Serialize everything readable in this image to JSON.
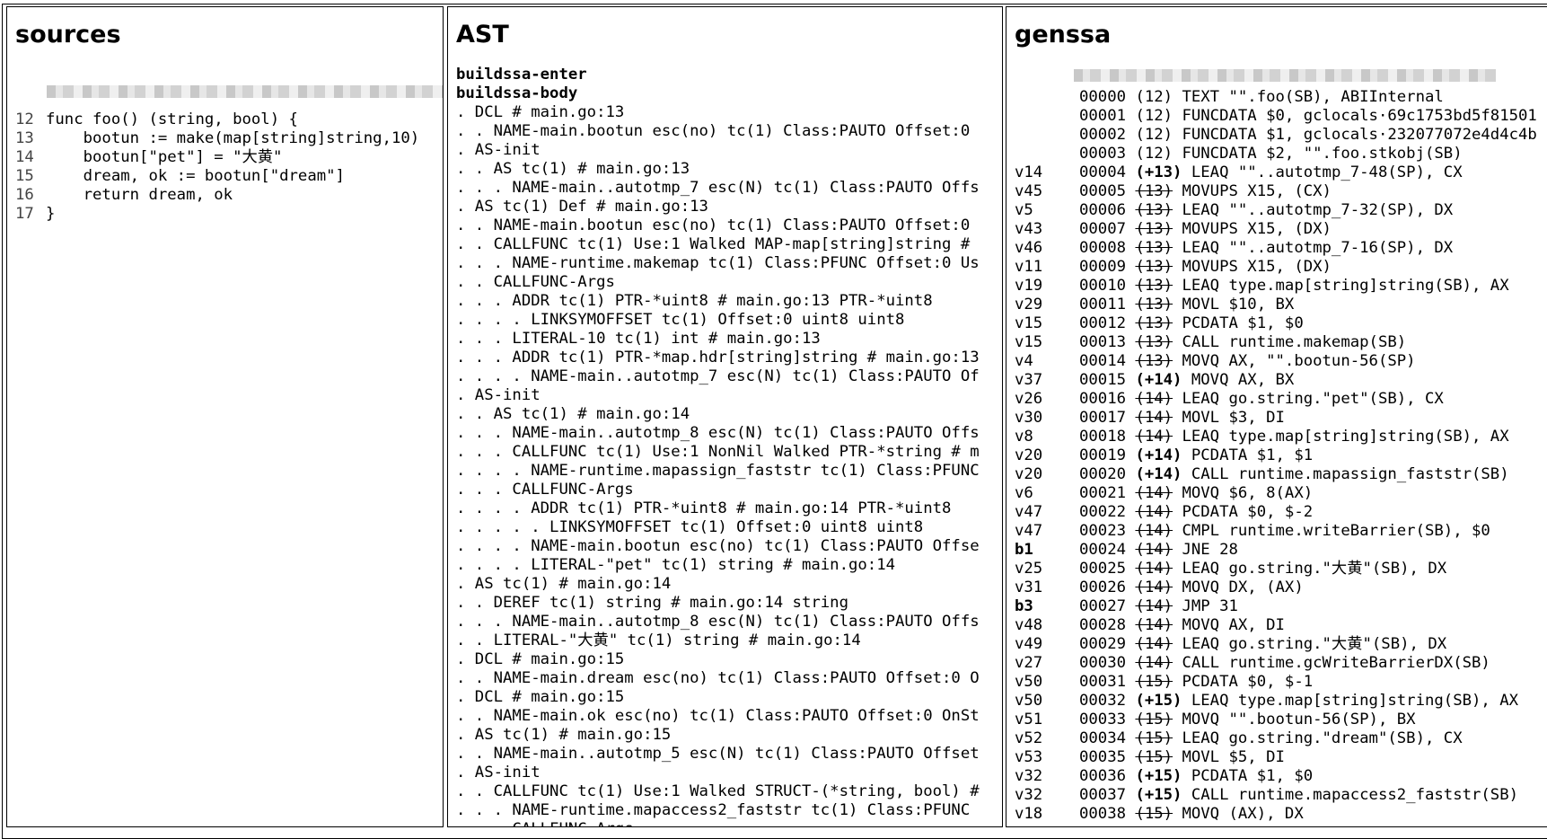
{
  "panels": {
    "sources": {
      "title": "sources",
      "lines": [
        {
          "num": "12",
          "text": "func foo() (string, bool) {"
        },
        {
          "num": "13",
          "text": "    bootun := make(map[string]string,10)"
        },
        {
          "num": "14",
          "text": "    bootun[\"pet\"] = \"大黄\""
        },
        {
          "num": "15",
          "text": "    dream, ok := bootun[\"dream\"]"
        },
        {
          "num": "16",
          "text": "    return dream, ok"
        },
        {
          "num": "17",
          "text": "}"
        }
      ]
    },
    "ast": {
      "title": "AST",
      "headers": [
        "buildssa-enter",
        "buildssa-body"
      ],
      "lines": [
        ". DCL # main.go:13",
        ". . NAME-main.bootun esc(no) tc(1) Class:PAUTO Offset:0",
        ". AS-init",
        ". . AS tc(1) # main.go:13",
        ". . . NAME-main..autotmp_7 esc(N) tc(1) Class:PAUTO Offs",
        ". AS tc(1) Def # main.go:13",
        ". . NAME-main.bootun esc(no) tc(1) Class:PAUTO Offset:0",
        ". . CALLFUNC tc(1) Use:1 Walked MAP-map[string]string #",
        ". . . NAME-runtime.makemap tc(1) Class:PFUNC Offset:0 Us",
        ". . CALLFUNC-Args",
        ". . . ADDR tc(1) PTR-*uint8 # main.go:13 PTR-*uint8",
        ". . . . LINKSYMOFFSET tc(1) Offset:0 uint8 uint8",
        ". . . LITERAL-10 tc(1) int # main.go:13",
        ". . . ADDR tc(1) PTR-*map.hdr[string]string # main.go:13",
        ". . . . NAME-main..autotmp_7 esc(N) tc(1) Class:PAUTO Of",
        ". AS-init",
        ". . AS tc(1) # main.go:14",
        ". . . NAME-main..autotmp_8 esc(N) tc(1) Class:PAUTO Offs",
        ". . . CALLFUNC tc(1) Use:1 NonNil Walked PTR-*string # m",
        ". . . . NAME-runtime.mapassign_faststr tc(1) Class:PFUNC",
        ". . . CALLFUNC-Args",
        ". . . . ADDR tc(1) PTR-*uint8 # main.go:14 PTR-*uint8",
        ". . . . . LINKSYMOFFSET tc(1) Offset:0 uint8 uint8",
        ". . . . NAME-main.bootun esc(no) tc(1) Class:PAUTO Offse",
        ". . . . LITERAL-\"pet\" tc(1) string # main.go:14",
        ". AS tc(1) # main.go:14",
        ". . DEREF tc(1) string # main.go:14 string",
        ". . . NAME-main..autotmp_8 esc(N) tc(1) Class:PAUTO Offs",
        ". . LITERAL-\"大黄\" tc(1) string # main.go:14",
        ". DCL # main.go:15",
        ". . NAME-main.dream esc(no) tc(1) Class:PAUTO Offset:0 O",
        ". DCL # main.go:15",
        ". . NAME-main.ok esc(no) tc(1) Class:PAUTO Offset:0 OnSt",
        ". AS tc(1) # main.go:15",
        ". . NAME-main..autotmp_5 esc(N) tc(1) Class:PAUTO Offset",
        ". AS-init",
        ". . CALLFUNC tc(1) Use:1 Walked STRUCT-(*string, bool) #",
        ". . . NAME-runtime.mapaccess2_faststr tc(1) Class:PFUNC",
        ". . . CALLFUNC-Args"
      ]
    },
    "genssa": {
      "title": "genssa",
      "lines": [
        {
          "v": "",
          "vb": false,
          "addr": "00000",
          "pos": "(12)",
          "ps": "n",
          "instr": "TEXT \"\".foo(SB), ABIInternal"
        },
        {
          "v": "",
          "vb": false,
          "addr": "00001",
          "pos": "(12)",
          "ps": "n",
          "instr": "FUNCDATA $0, gclocals·69c1753bd5f81501"
        },
        {
          "v": "",
          "vb": false,
          "addr": "00002",
          "pos": "(12)",
          "ps": "n",
          "instr": "FUNCDATA $1, gclocals·232077072e4d4c4b"
        },
        {
          "v": "",
          "vb": false,
          "addr": "00003",
          "pos": "(12)",
          "ps": "n",
          "instr": "FUNCDATA $2, \"\".foo.stkobj(SB)"
        },
        {
          "v": "v14",
          "vb": false,
          "addr": "00004",
          "pos": "(+13)",
          "ps": "s",
          "instr": "LEAQ \"\"..autotmp_7-48(SP), CX"
        },
        {
          "v": "v45",
          "vb": false,
          "addr": "00005",
          "pos": "(13)",
          "ps": "d",
          "instr": "MOVUPS X15, (CX)"
        },
        {
          "v": "v5",
          "vb": false,
          "addr": "00006",
          "pos": "(13)",
          "ps": "d",
          "instr": "LEAQ \"\"..autotmp_7-32(SP), DX"
        },
        {
          "v": "v43",
          "vb": false,
          "addr": "00007",
          "pos": "(13)",
          "ps": "d",
          "instr": "MOVUPS X15, (DX)"
        },
        {
          "v": "v46",
          "vb": false,
          "addr": "00008",
          "pos": "(13)",
          "ps": "d",
          "instr": "LEAQ \"\"..autotmp_7-16(SP), DX"
        },
        {
          "v": "v11",
          "vb": false,
          "addr": "00009",
          "pos": "(13)",
          "ps": "d",
          "instr": "MOVUPS X15, (DX)"
        },
        {
          "v": "v19",
          "vb": false,
          "addr": "00010",
          "pos": "(13)",
          "ps": "d",
          "instr": "LEAQ type.map[string]string(SB), AX"
        },
        {
          "v": "v29",
          "vb": false,
          "addr": "00011",
          "pos": "(13)",
          "ps": "d",
          "instr": "MOVL $10, BX"
        },
        {
          "v": "v15",
          "vb": false,
          "addr": "00012",
          "pos": "(13)",
          "ps": "d",
          "instr": "PCDATA $1, $0"
        },
        {
          "v": "v15",
          "vb": false,
          "addr": "00013",
          "pos": "(13)",
          "ps": "d",
          "instr": "CALL runtime.makemap(SB)"
        },
        {
          "v": "v4",
          "vb": false,
          "addr": "00014",
          "pos": "(13)",
          "ps": "d",
          "instr": "MOVQ AX, \"\".bootun-56(SP)"
        },
        {
          "v": "v37",
          "vb": false,
          "addr": "00015",
          "pos": "(+14)",
          "ps": "s",
          "instr": "MOVQ AX, BX"
        },
        {
          "v": "v26",
          "vb": false,
          "addr": "00016",
          "pos": "(14)",
          "ps": "d",
          "instr": "LEAQ go.string.\"pet\"(SB), CX"
        },
        {
          "v": "v30",
          "vb": false,
          "addr": "00017",
          "pos": "(14)",
          "ps": "d",
          "instr": "MOVL $3, DI"
        },
        {
          "v": "v8",
          "vb": false,
          "addr": "00018",
          "pos": "(14)",
          "ps": "d",
          "instr": "LEAQ type.map[string]string(SB), AX"
        },
        {
          "v": "v20",
          "vb": false,
          "addr": "00019",
          "pos": "(+14)",
          "ps": "s",
          "instr": "PCDATA $1, $1"
        },
        {
          "v": "v20",
          "vb": false,
          "addr": "00020",
          "pos": "(+14)",
          "ps": "s",
          "instr": "CALL runtime.mapassign_faststr(SB)"
        },
        {
          "v": "v6",
          "vb": false,
          "addr": "00021",
          "pos": "(14)",
          "ps": "d",
          "instr": "MOVQ $6, 8(AX)"
        },
        {
          "v": "v47",
          "vb": false,
          "addr": "00022",
          "pos": "(14)",
          "ps": "d",
          "instr": "PCDATA $0, $-2"
        },
        {
          "v": "v47",
          "vb": false,
          "addr": "00023",
          "pos": "(14)",
          "ps": "d",
          "instr": "CMPL runtime.writeBarrier(SB), $0"
        },
        {
          "v": "b1",
          "vb": true,
          "addr": "00024",
          "pos": "(14)",
          "ps": "d",
          "instr": "JNE 28"
        },
        {
          "v": "v25",
          "vb": false,
          "addr": "00025",
          "pos": "(14)",
          "ps": "d",
          "instr": "LEAQ go.string.\"大黄\"(SB), DX"
        },
        {
          "v": "v31",
          "vb": false,
          "addr": "00026",
          "pos": "(14)",
          "ps": "d",
          "instr": "MOVQ DX, (AX)"
        },
        {
          "v": "b3",
          "vb": true,
          "addr": "00027",
          "pos": "(14)",
          "ps": "d",
          "instr": "JMP 31"
        },
        {
          "v": "v48",
          "vb": false,
          "addr": "00028",
          "pos": "(14)",
          "ps": "d",
          "instr": "MOVQ AX, DI"
        },
        {
          "v": "v49",
          "vb": false,
          "addr": "00029",
          "pos": "(14)",
          "ps": "d",
          "instr": "LEAQ go.string.\"大黄\"(SB), DX"
        },
        {
          "v": "v27",
          "vb": false,
          "addr": "00030",
          "pos": "(14)",
          "ps": "d",
          "instr": "CALL runtime.gcWriteBarrierDX(SB)"
        },
        {
          "v": "v50",
          "vb": false,
          "addr": "00031",
          "pos": "(15)",
          "ps": "d",
          "instr": "PCDATA $0, $-1"
        },
        {
          "v": "v50",
          "vb": false,
          "addr": "00032",
          "pos": "(+15)",
          "ps": "s",
          "instr": "LEAQ type.map[string]string(SB), AX"
        },
        {
          "v": "v51",
          "vb": false,
          "addr": "00033",
          "pos": "(15)",
          "ps": "d",
          "instr": "MOVQ \"\".bootun-56(SP), BX"
        },
        {
          "v": "v52",
          "vb": false,
          "addr": "00034",
          "pos": "(15)",
          "ps": "d",
          "instr": "LEAQ go.string.\"dream\"(SB), CX"
        },
        {
          "v": "v53",
          "vb": false,
          "addr": "00035",
          "pos": "(15)",
          "ps": "d",
          "instr": "MOVL $5, DI"
        },
        {
          "v": "v32",
          "vb": false,
          "addr": "00036",
          "pos": "(+15)",
          "ps": "s",
          "instr": "PCDATA $1, $0"
        },
        {
          "v": "v32",
          "vb": false,
          "addr": "00037",
          "pos": "(+15)",
          "ps": "s",
          "instr": "CALL runtime.mapaccess2_faststr(SB)"
        },
        {
          "v": "v18",
          "vb": false,
          "addr": "00038",
          "pos": "(15)",
          "ps": "d",
          "instr": "MOVQ (AX), DX"
        }
      ]
    }
  }
}
